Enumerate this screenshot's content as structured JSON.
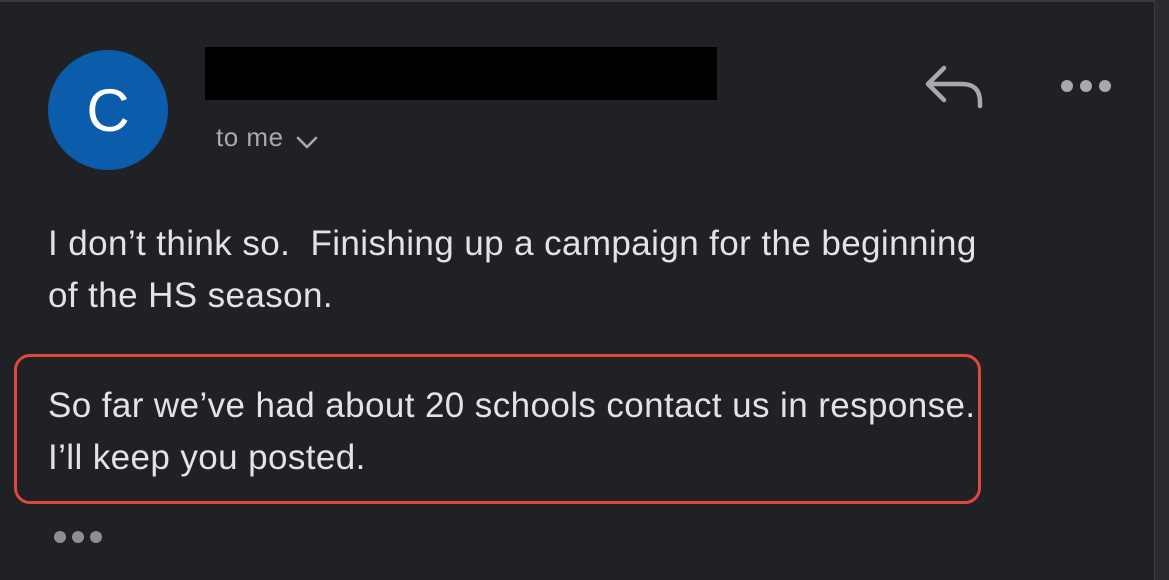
{
  "email": {
    "avatar_letter": "C",
    "avatar_color": "#0b5cab",
    "sender_name": "",
    "recipient_label": "to me",
    "body": {
      "paragraph_1": "I don’t think so.  Finishing up a campaign for the beginning of the HS season.",
      "paragraph_2": "So far we’ve had about 20 schools contact us in response. I’ll keep you posted."
    }
  },
  "icons": {
    "reply": "reply-arrow-icon",
    "more": "more-options-icon",
    "expand_recipients": "chevron-down-icon",
    "trimmed_content": "ellipsis-icon"
  },
  "colors": {
    "background": "#202124",
    "text": "#e3e3e6",
    "secondary_text": "#a8a9ad",
    "highlight_border": "#e0483e",
    "redaction": "#000000"
  }
}
